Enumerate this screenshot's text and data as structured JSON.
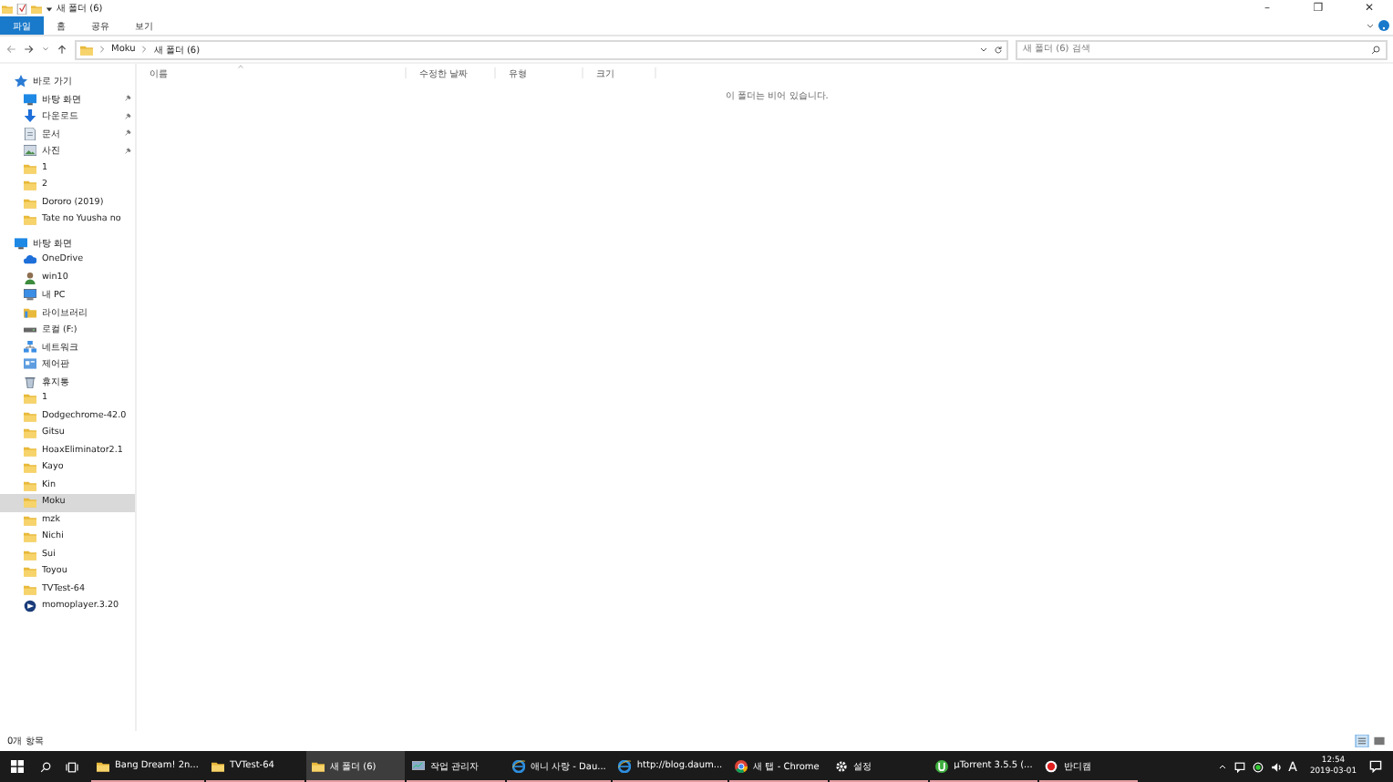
{
  "window": {
    "title": "새 폴더 (6)",
    "controls": [
      "–",
      "❐",
      "✕"
    ]
  },
  "ribbon": {
    "tabs": [
      {
        "label": "파일",
        "selected": true
      },
      {
        "label": "홈",
        "selected": false
      },
      {
        "label": "공유",
        "selected": false
      },
      {
        "label": "보기",
        "selected": false
      }
    ]
  },
  "address": {
    "path": [
      "Moku",
      "새 폴더 (6)"
    ],
    "search": {
      "placeholder": "새 폴더 (6) 검색"
    }
  },
  "sidebar": {
    "items": [
      {
        "label": "바로 가기",
        "kind": "star",
        "selected": false,
        "children": [
          {
            "label": "바탕 화면",
            "kind": "desktop",
            "pinned": true,
            "selected": false
          },
          {
            "label": "다운로드",
            "kind": "download",
            "pinned": true,
            "selected": false
          },
          {
            "label": "문서",
            "kind": "document",
            "pinned": true,
            "selected": false
          },
          {
            "label": "사진",
            "kind": "picture",
            "pinned": true,
            "selected": false
          },
          {
            "label": "1",
            "kind": "folder",
            "pinned": false,
            "selected": false
          },
          {
            "label": "2",
            "kind": "folder",
            "pinned": false,
            "selected": false
          },
          {
            "label": "Dororo (2019)",
            "kind": "folder",
            "pinned": false,
            "selected": false
          },
          {
            "label": "Tate no Yuusha no",
            "kind": "folder",
            "pinned": false,
            "selected": false
          }
        ]
      },
      {
        "label": "바탕 화면",
        "kind": "desktop",
        "selected": false,
        "children": [
          {
            "label": "OneDrive",
            "kind": "cloud",
            "selected": false
          },
          {
            "label": "win10",
            "kind": "user",
            "selected": false
          },
          {
            "label": "내 PC",
            "kind": "pc",
            "selected": false
          },
          {
            "label": "라이브러리",
            "kind": "library",
            "selected": false
          },
          {
            "label": "로컬 (F:)",
            "kind": "drive",
            "selected": false
          },
          {
            "label": "네트워크",
            "kind": "network",
            "selected": false
          },
          {
            "label": "제어판",
            "kind": "control",
            "selected": false
          },
          {
            "label": "휴지통",
            "kind": "recycle",
            "selected": false
          },
          {
            "label": "1",
            "kind": "folder",
            "selected": false
          },
          {
            "label": "Dodgechrome-42.0",
            "kind": "folder",
            "selected": false
          },
          {
            "label": "Gitsu",
            "kind": "folder",
            "selected": false
          },
          {
            "label": "HoaxEliminator2.1",
            "kind": "folder",
            "selected": false
          },
          {
            "label": "Kayo",
            "kind": "folder",
            "selected": false
          },
          {
            "label": "Kin",
            "kind": "folder",
            "selected": false
          },
          {
            "label": "Moku",
            "kind": "folder",
            "selected": true
          },
          {
            "label": "mzk",
            "kind": "folder",
            "selected": false
          },
          {
            "label": "Nichi",
            "kind": "folder",
            "selected": false
          },
          {
            "label": "Sui",
            "kind": "folder",
            "selected": false
          },
          {
            "label": "Toyou",
            "kind": "folder",
            "selected": false
          },
          {
            "label": "TVTest-64",
            "kind": "folder",
            "selected": false
          },
          {
            "label": "momoplayer.3.20",
            "kind": "app",
            "selected": false
          }
        ]
      }
    ]
  },
  "table": {
    "columns": [
      "이름",
      "수정한 날짜",
      "유형",
      "크기"
    ],
    "empty_message": "이 폴더는 비어 있습니다."
  },
  "status_bar": {
    "text": "0개 항목"
  },
  "taskbar": {
    "items": [
      {
        "label": "Bang Dream! 2n...",
        "kind": "folder",
        "selected": false
      },
      {
        "label": "TVTest-64",
        "kind": "folder",
        "selected": false
      },
      {
        "label": "새 폴더 (6)",
        "kind": "folder",
        "selected": true
      },
      {
        "label": "작업 관리자",
        "kind": "monitor",
        "selected": false
      },
      {
        "label": "애니 사랑 - Dau...",
        "kind": "ie",
        "selected": false
      },
      {
        "label": "http://blog.daum...",
        "kind": "ie",
        "selected": false
      },
      {
        "label": "새 탭 - Chrome",
        "kind": "chrome",
        "selected": false
      },
      {
        "label": "설정",
        "kind": "gear",
        "selected": false
      },
      {
        "label": "µTorrent 3.5.5 (...",
        "kind": "torrent",
        "selected": false
      },
      {
        "label": "반디캠",
        "kind": "record",
        "selected": false
      }
    ],
    "ime": "A",
    "time": "12:54",
    "date": "2019-03-01"
  }
}
